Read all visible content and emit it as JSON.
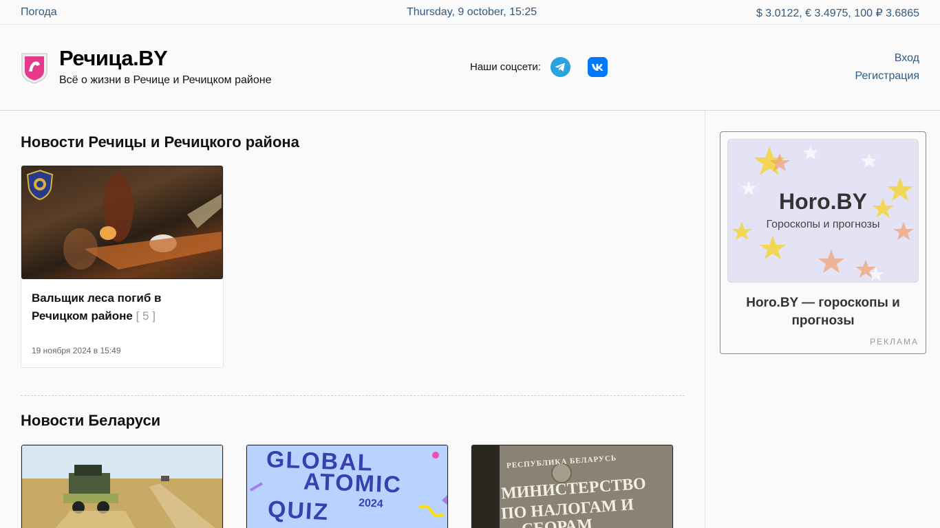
{
  "topbar": {
    "weather": "Погода",
    "date": "Thursday, 9 october, 15:25",
    "rates": "$ 3.0122, € 3.4975, 100 ₽ 3.6865"
  },
  "header": {
    "title": "Речица.BY",
    "subtitle": "Всё о жизни в Речице и Речицком районе",
    "social_label": "Наши соцсети:",
    "login": "Вход",
    "register": "Регистрация"
  },
  "sections": {
    "local_title": "Новости Речицы и Речицкого района",
    "belarus_title": "Новости Беларуси"
  },
  "local_news": {
    "title": "Вальщик леса погиб в Речицком районе",
    "count": "[ 5 ]",
    "date": "19 ноября 2024 в 15:49"
  },
  "belarus_news": {
    "quiz_line1": "GLOBAL",
    "quiz_line2": "ATOMIC",
    "quiz_line3": "QUIZ",
    "quiz_year": "2024",
    "ministry_line0": "РЕСПУБЛИКА БЕЛАРУСЬ",
    "ministry_line1": "МИНИСТЕРСТВО",
    "ministry_line2": "ПО НАЛОГАМ И",
    "ministry_line3": "СБОРАМ"
  },
  "ad": {
    "brand": "Horo.BY",
    "tagline": "Гороскопы и прогнозы",
    "title": "Horo.BY — гороскопы и прогнозы",
    "label": "РЕКЛАМА"
  },
  "colors": {
    "link": "#2f5a84",
    "telegram": "#2aa3df",
    "vk": "#0077ff",
    "logo_pink": "#e5398c"
  },
  "icons": {
    "logo": "rechitsa-coat-of-arms-icon",
    "telegram": "telegram-icon",
    "vk": "vk-icon"
  }
}
